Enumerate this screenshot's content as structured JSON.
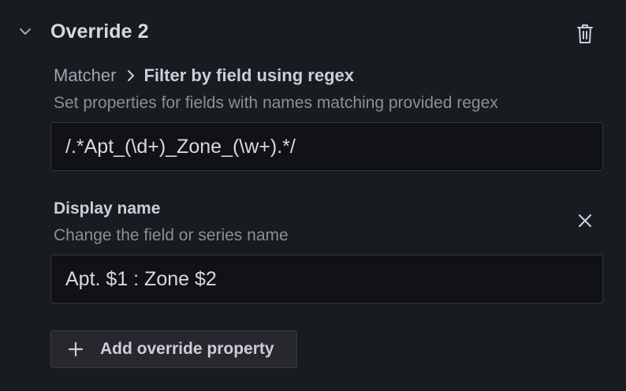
{
  "override": {
    "title": "Override 2",
    "icons": {
      "collapse": "chevron-down-icon",
      "delete": "trash-icon"
    }
  },
  "matcher": {
    "label": "Matcher",
    "separator_icon": "chevron-right-icon",
    "value": "Filter by field using regex",
    "description": "Set properties for fields with names matching provided regex",
    "input_value": "/.*Apt_(\\d+)_Zone_(\\w+).*/"
  },
  "property": {
    "title": "Display name",
    "description": "Change the field or series name",
    "input_value": "Apt. $1 : Zone $2",
    "remove_icon": "close-icon"
  },
  "add_property": {
    "icon": "plus-icon",
    "label": "Add override property"
  },
  "colors": {
    "background": "#181b1f",
    "input_background": "#111217",
    "border": "#34363c",
    "text_primary": "#d8d9e0",
    "text_secondary": "#8e8e96",
    "button_background": "#26282d"
  }
}
